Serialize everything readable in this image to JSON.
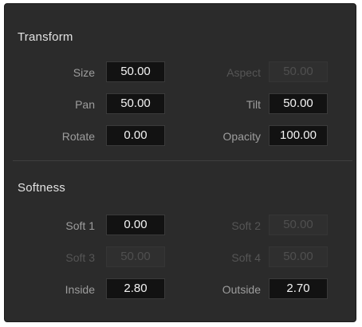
{
  "transform": {
    "title": "Transform",
    "size": {
      "label": "Size",
      "value": "50.00"
    },
    "aspect": {
      "label": "Aspect",
      "value": "50.00"
    },
    "pan": {
      "label": "Pan",
      "value": "50.00"
    },
    "tilt": {
      "label": "Tilt",
      "value": "50.00"
    },
    "rotate": {
      "label": "Rotate",
      "value": "0.00"
    },
    "opacity": {
      "label": "Opacity",
      "value": "100.00"
    }
  },
  "softness": {
    "title": "Softness",
    "soft1": {
      "label": "Soft 1",
      "value": "0.00"
    },
    "soft2": {
      "label": "Soft 2",
      "value": "50.00"
    },
    "soft3": {
      "label": "Soft 3",
      "value": "50.00"
    },
    "soft4": {
      "label": "Soft 4",
      "value": "50.00"
    },
    "inside": {
      "label": "Inside",
      "value": "2.80"
    },
    "outside": {
      "label": "Outside",
      "value": "2.70"
    }
  }
}
